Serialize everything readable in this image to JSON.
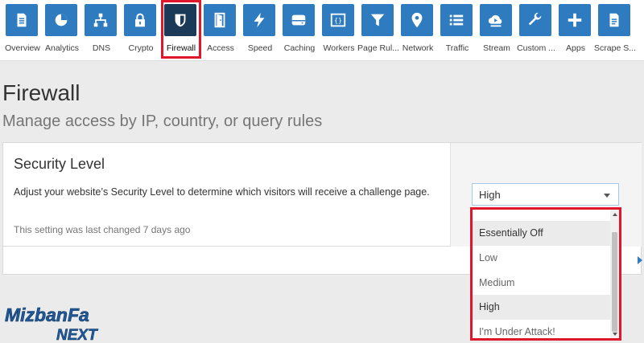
{
  "nav": {
    "items": [
      {
        "label": "Overview",
        "icon": "document-icon"
      },
      {
        "label": "Analytics",
        "icon": "pie-chart-icon"
      },
      {
        "label": "DNS",
        "icon": "network-tree-icon"
      },
      {
        "label": "Crypto",
        "icon": "lock-icon"
      },
      {
        "label": "Firewall",
        "icon": "shield-icon"
      },
      {
        "label": "Access",
        "icon": "door-icon"
      },
      {
        "label": "Speed",
        "icon": "lightning-icon"
      },
      {
        "label": "Caching",
        "icon": "drive-icon"
      },
      {
        "label": "Workers",
        "icon": "code-braces-icon"
      },
      {
        "label": "Page Rul...",
        "icon": "filter-icon"
      },
      {
        "label": "Network",
        "icon": "location-pin-icon"
      },
      {
        "label": "Traffic",
        "icon": "list-icon"
      },
      {
        "label": "Stream",
        "icon": "cloud-play-icon"
      },
      {
        "label": "Custom ...",
        "icon": "wrench-icon"
      },
      {
        "label": "Apps",
        "icon": "plus-icon"
      },
      {
        "label": "Scrape S...",
        "icon": "page-icon"
      }
    ],
    "active": "Firewall"
  },
  "page": {
    "title": "Firewall",
    "subtitle": "Manage access by IP, country, or query rules"
  },
  "security_level": {
    "title": "Security Level",
    "description": "Adjust your website’s Security Level to determine which visitors will receive a challenge page.",
    "last_changed": "This setting was last changed 7 days ago",
    "selected": "High",
    "options": [
      "Essentially Off",
      "Low",
      "Medium",
      "High",
      "I'm Under Attack!"
    ],
    "highlighted": "Essentially Off"
  },
  "logo": {
    "top": "MizbanFa",
    "bottom": "NEXT"
  },
  "colors": {
    "nav_blue": "#2f7bbf",
    "nav_active": "#1b3a57",
    "highlight_red": "#e0162b"
  }
}
